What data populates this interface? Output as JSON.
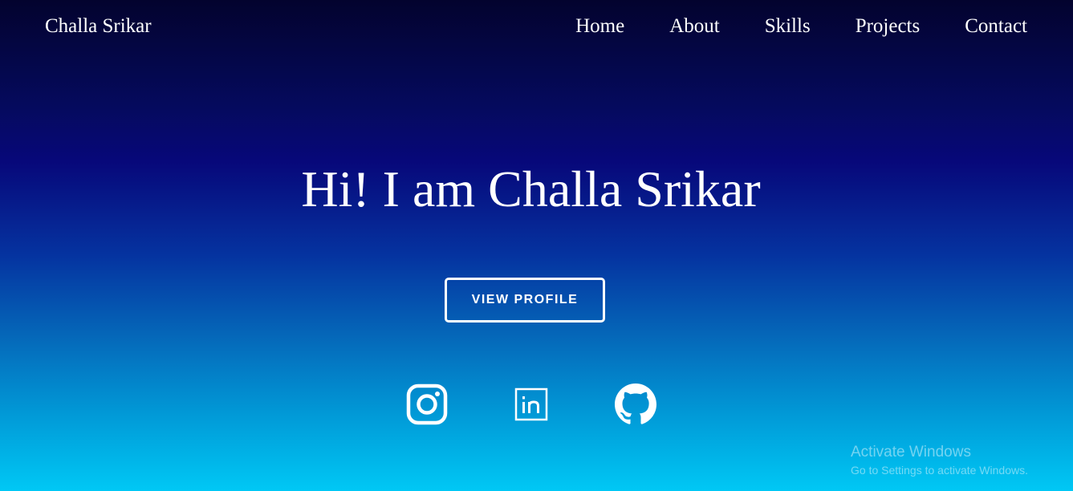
{
  "header": {
    "brand": "Challa Srikar",
    "nav": [
      {
        "label": "Home"
      },
      {
        "label": "About"
      },
      {
        "label": "Skills"
      },
      {
        "label": "Projects"
      },
      {
        "label": "Contact"
      }
    ]
  },
  "hero": {
    "title": "Hi! I am Challa Srikar",
    "cta_label": "VIEW PROFILE"
  },
  "social": [
    {
      "icon": "instagram-icon"
    },
    {
      "icon": "linkedin-icon"
    },
    {
      "icon": "github-icon"
    }
  ],
  "watermark": {
    "title": "Activate Windows",
    "subtitle": "Go to Settings to activate Windows."
  },
  "colors": {
    "gradient_top": "#03032e",
    "gradient_mid": "#07087a",
    "gradient_bottom": "#00c8f5",
    "text": "#ffffff"
  }
}
